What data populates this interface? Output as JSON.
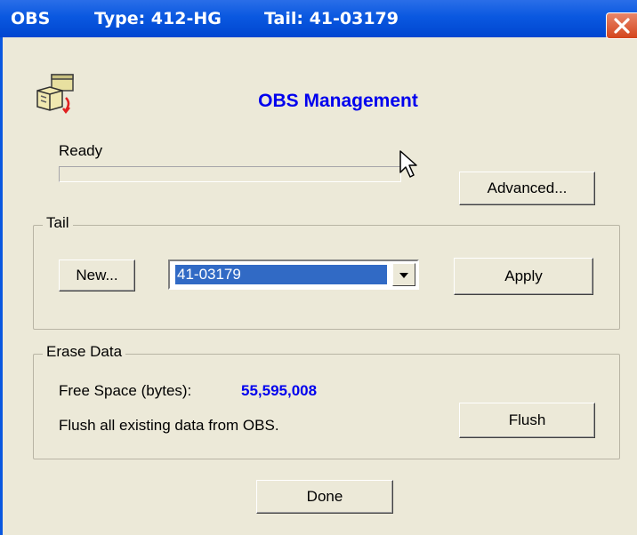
{
  "titlebar": {
    "app": "OBS",
    "type": "Type: 412-HG",
    "tail": "Tail: 41-03179"
  },
  "header": {
    "title": "OBS Management"
  },
  "status": {
    "text": "Ready",
    "progress": 0
  },
  "buttons": {
    "advanced": "Advanced...",
    "new": "New...",
    "apply": "Apply",
    "flush": "Flush",
    "done": "Done"
  },
  "tail_group": {
    "label": "Tail",
    "selected": "41-03179"
  },
  "erase_group": {
    "label": "Erase Data",
    "free_space_label": "Free Space (bytes):",
    "free_space_value": "55,595,008",
    "flush_description": "Flush all existing data from OBS."
  },
  "colors": {
    "titlebar": "#0a58e0",
    "accent_text": "#0000ee",
    "dialog_bg": "#ece9d8",
    "selection": "#316ac5",
    "close_button": "#d4441c"
  },
  "icons": [
    "app-folder-icon",
    "close-icon",
    "dropdown-arrow-icon",
    "mouse-pointer-icon"
  ]
}
